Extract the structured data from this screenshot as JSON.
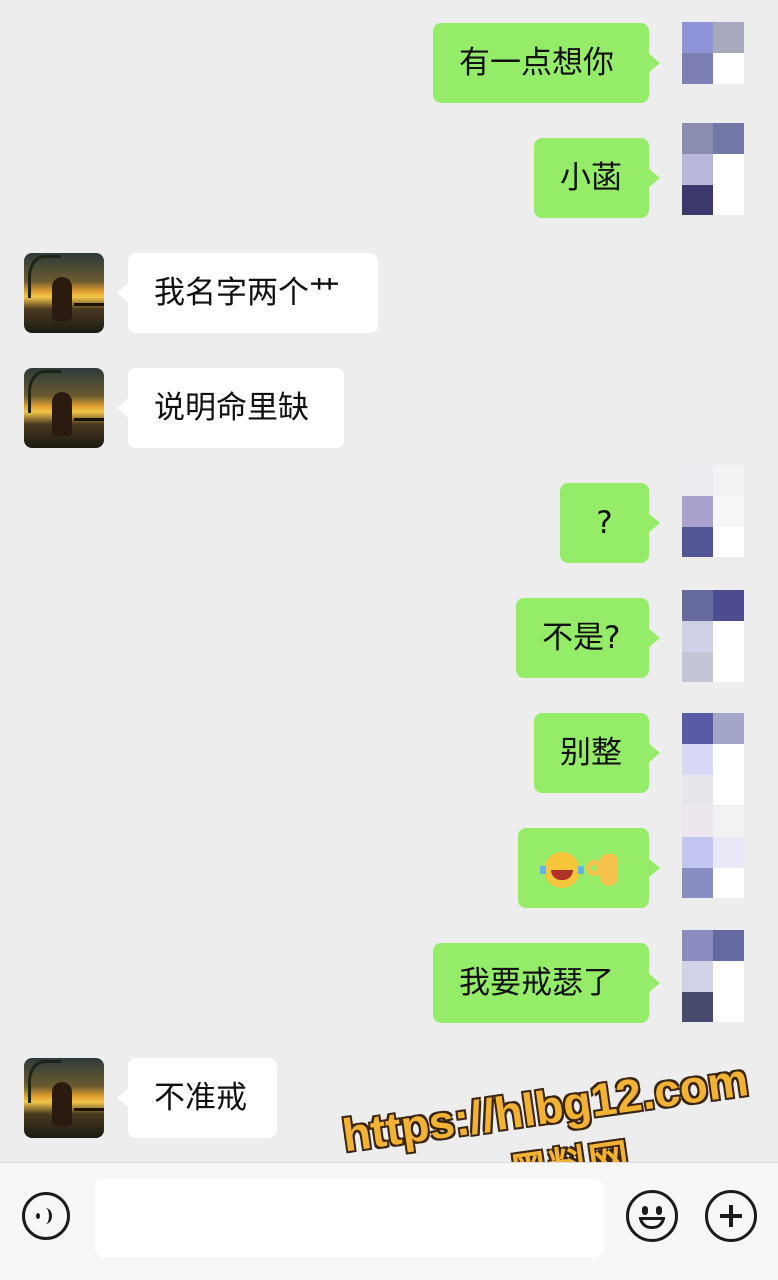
{
  "messages": [
    {
      "side": "right",
      "text": "有一点想你",
      "avatar_colors": [
        "#8f94d8",
        "#a6a8bd",
        "#7f7fb8",
        "#ffffff",
        "",
        ""
      ]
    },
    {
      "side": "right",
      "text": "小菡",
      "avatar_colors": [
        "#8a8cb0",
        "#7478a6",
        "#b9b8db",
        "#ffffff",
        "#3c3a6c",
        "#ffffff"
      ]
    },
    {
      "side": "left",
      "text": "我名字两个艹"
    },
    {
      "side": "left",
      "text": "说明命里缺"
    },
    {
      "side": "right",
      "text": "?",
      "avatar_colors": [
        "#ececf2",
        "#f3f3f6",
        "#a9a2cf",
        "#f6f6f6",
        "#525596",
        "#ffffff"
      ]
    },
    {
      "side": "right",
      "text": "不是?",
      "avatar_colors": [
        "#666a9e",
        "#4d4c8e",
        "#cfcfe8",
        "#ffffff",
        "#c4c6d6",
        "#ffffff"
      ]
    },
    {
      "side": "right",
      "text": "别整",
      "avatar_colors": [
        "#5a5ba6",
        "#a3a5c9",
        "#d8d9f6",
        "#ffffff",
        "#e6e6ec",
        "#ffffff"
      ]
    },
    {
      "side": "right",
      "text": "",
      "emoji": [
        "loudly-crying-face",
        "ok-hand"
      ],
      "avatar_colors": [
        "#ebe7ec",
        "#f2f2f4",
        "#c3c6f0",
        "#e8e8f6",
        "#8a8dc2",
        "#ffffff"
      ]
    },
    {
      "side": "right",
      "text": "我要戒瑟了",
      "avatar_colors": [
        "#8a8cc0",
        "#6469a2",
        "#d1d1e8",
        "#ffffff",
        "#474c6c",
        "#ffffff"
      ]
    },
    {
      "side": "left",
      "text": "不准戒"
    }
  ],
  "watermark": {
    "url": "https://hlbg12.com",
    "site": "黑料网",
    "color": "#f2b233"
  },
  "input_bar": {
    "icons": [
      "voice-icon",
      "emoji-icon",
      "plus-icon"
    ]
  },
  "colors": {
    "sent_bubble": "#95ec69",
    "received_bubble": "#ffffff",
    "background": "#ededed"
  }
}
